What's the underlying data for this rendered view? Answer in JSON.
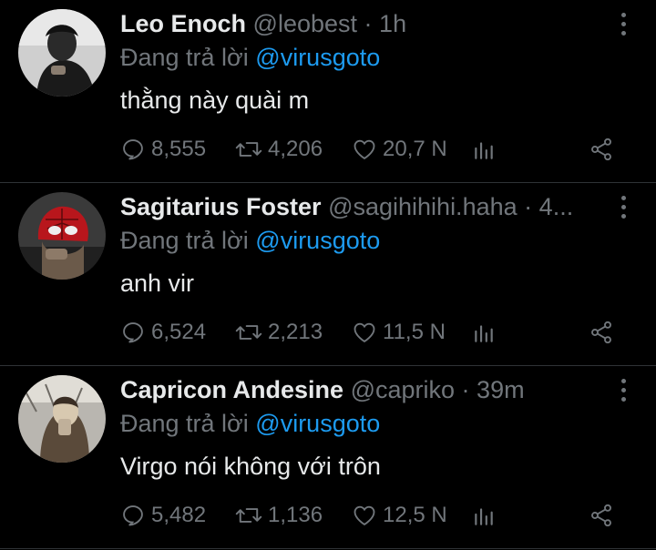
{
  "colors": {
    "background": "#000000",
    "text": "#e7e9ea",
    "muted": "#71767b",
    "mention": "#1d9bf0",
    "divider": "#2f3336"
  },
  "tweets": [
    {
      "name": "Leo Enoch",
      "handle": "@leobest",
      "separator": "·",
      "time": "1h",
      "reply_prefix": "Đang trả lời",
      "reply_to": "@virusgoto",
      "text": "thằng này quài m",
      "replies": "8,555",
      "retweets": "4,206",
      "likes": "20,7 N"
    },
    {
      "name": "Sagitarius Foster",
      "handle": "@sagihihihi.haha",
      "separator": "·",
      "time": "4...",
      "reply_prefix": "Đang trả lời",
      "reply_to": "@virusgoto",
      "text": "anh vir",
      "replies": "6,524",
      "retweets": "2,213",
      "likes": "11,5 N"
    },
    {
      "name": "Capricon Andesine",
      "handle": "@capriko",
      "separator": "·",
      "time": "39m",
      "reply_prefix": "Đang trả lời",
      "reply_to": "@virusgoto",
      "text": "Virgo nói không với trôn",
      "replies": "5,482",
      "retweets": "1,136",
      "likes": "12,5 N"
    }
  ],
  "icons": {
    "more": "more-vertical-icon",
    "reply": "reply-bubble-icon",
    "retweet": "retweet-icon",
    "like": "heart-icon",
    "views": "analytics-icon",
    "share": "share-icon"
  }
}
